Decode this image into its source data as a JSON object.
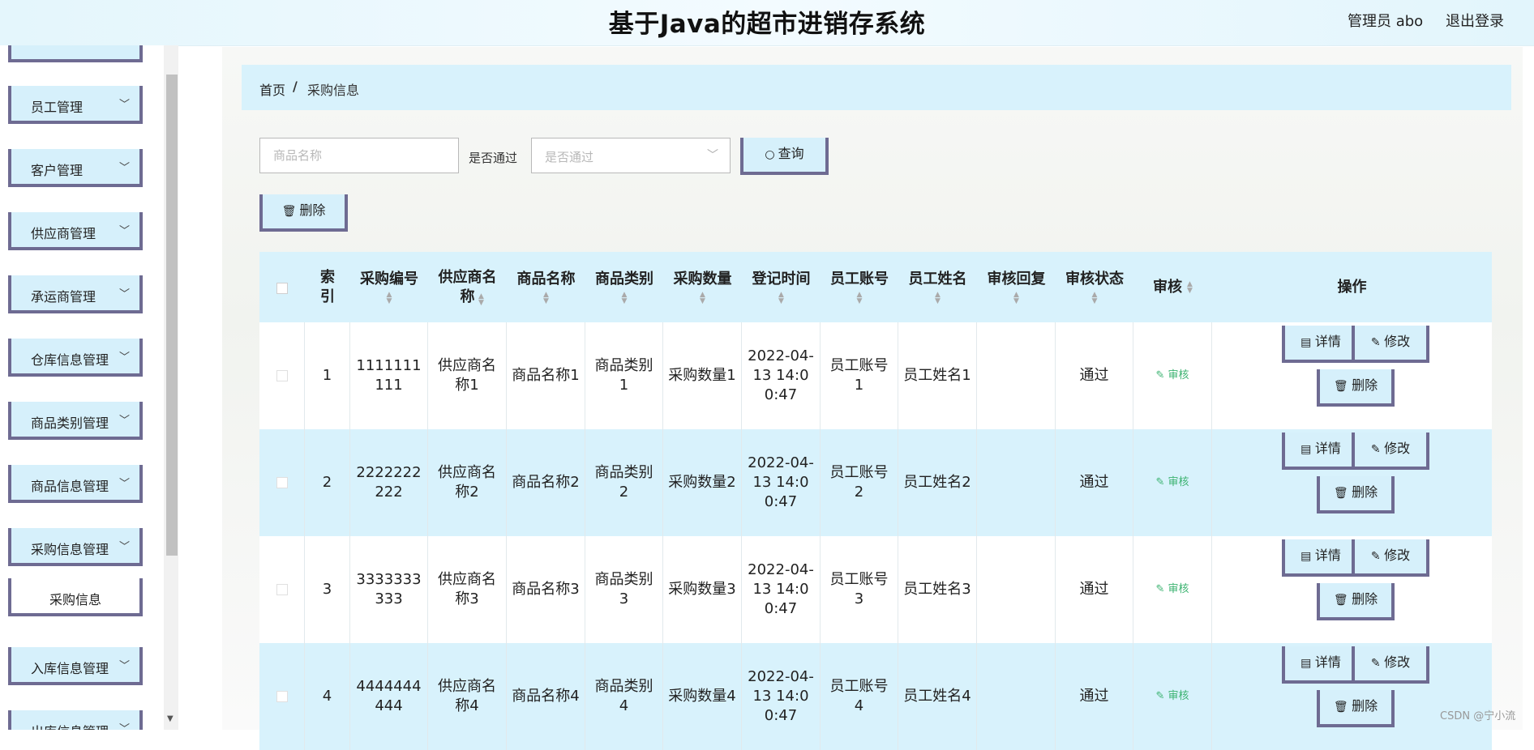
{
  "header": {
    "title": "基于Java的超市进销存系统",
    "user_label": "管理员 abo",
    "logout_label": "退出登录"
  },
  "sidebar": {
    "items": [
      {
        "label": "",
        "name": "sidebar-item-partial"
      },
      {
        "label": "员工管理",
        "name": "sidebar-item-employee"
      },
      {
        "label": "客户管理",
        "name": "sidebar-item-customer"
      },
      {
        "label": "供应商管理",
        "name": "sidebar-item-supplier"
      },
      {
        "label": "承运商管理",
        "name": "sidebar-item-carrier"
      },
      {
        "label": "仓库信息管理",
        "name": "sidebar-item-warehouse"
      },
      {
        "label": "商品类别管理",
        "name": "sidebar-item-category"
      },
      {
        "label": "商品信息管理",
        "name": "sidebar-item-product"
      },
      {
        "label": "采购信息管理",
        "name": "sidebar-item-purchase"
      }
    ],
    "submenu_item": "采购信息",
    "after_items": [
      {
        "label": "入库信息管理",
        "name": "sidebar-item-inbound"
      },
      {
        "label": "出库信息管理",
        "name": "sidebar-item-outbound"
      }
    ]
  },
  "breadcrumb": {
    "home": "首页",
    "separator": "/",
    "current": "采购信息"
  },
  "search": {
    "product_placeholder": "商品名称",
    "passed_label": "是否通过",
    "passed_placeholder": "是否通过",
    "query_label": "查询"
  },
  "toolbar": {
    "delete_label": "删除"
  },
  "table": {
    "headers": {
      "index": "索引",
      "purchase_no": "采购编号",
      "supplier": "供应商名称",
      "product": "商品名称",
      "category": "商品类别",
      "qty": "采购数量",
      "reg_time": "登记时间",
      "emp_account": "员工账号",
      "emp_name": "员工姓名",
      "reply": "审核回复",
      "status": "审核状态",
      "audit": "审核",
      "ops": "操作"
    },
    "rows": [
      {
        "index": "1",
        "purchase_no": "1111111111",
        "supplier": "供应商名称1",
        "product": "商品名称1",
        "category": "商品类别1",
        "qty": "采购数量1",
        "reg_time": "2022-04-13 14:00:47",
        "emp_account": "员工账号1",
        "emp_name": "员工姓名1",
        "reply": "",
        "status": "通过",
        "audit": "审核"
      },
      {
        "index": "2",
        "purchase_no": "2222222222",
        "supplier": "供应商名称2",
        "product": "商品名称2",
        "category": "商品类别2",
        "qty": "采购数量2",
        "reg_time": "2022-04-13 14:00:47",
        "emp_account": "员工账号2",
        "emp_name": "员工姓名2",
        "reply": "",
        "status": "通过",
        "audit": "审核"
      },
      {
        "index": "3",
        "purchase_no": "3333333333",
        "supplier": "供应商名称3",
        "product": "商品名称3",
        "category": "商品类别3",
        "qty": "采购数量3",
        "reg_time": "2022-04-13 14:00:47",
        "emp_account": "员工账号3",
        "emp_name": "员工姓名3",
        "reply": "",
        "status": "通过",
        "audit": "审核"
      },
      {
        "index": "4",
        "purchase_no": "4444444444",
        "supplier": "供应商名称4",
        "product": "商品名称4",
        "category": "商品类别4",
        "qty": "采购数量4",
        "reg_time": "2022-04-13 14:00:47",
        "emp_account": "员工账号4",
        "emp_name": "员工姓名4",
        "reply": "",
        "status": "通过",
        "audit": "审核"
      }
    ],
    "row_actions": {
      "detail": "详情",
      "edit": "修改",
      "delete": "删除"
    }
  },
  "watermark": "CSDN @宁小流",
  "colors": {
    "accent_light": "#d8f2fc",
    "button_border": "#6e6b92",
    "audit_green": "#3cb371"
  }
}
